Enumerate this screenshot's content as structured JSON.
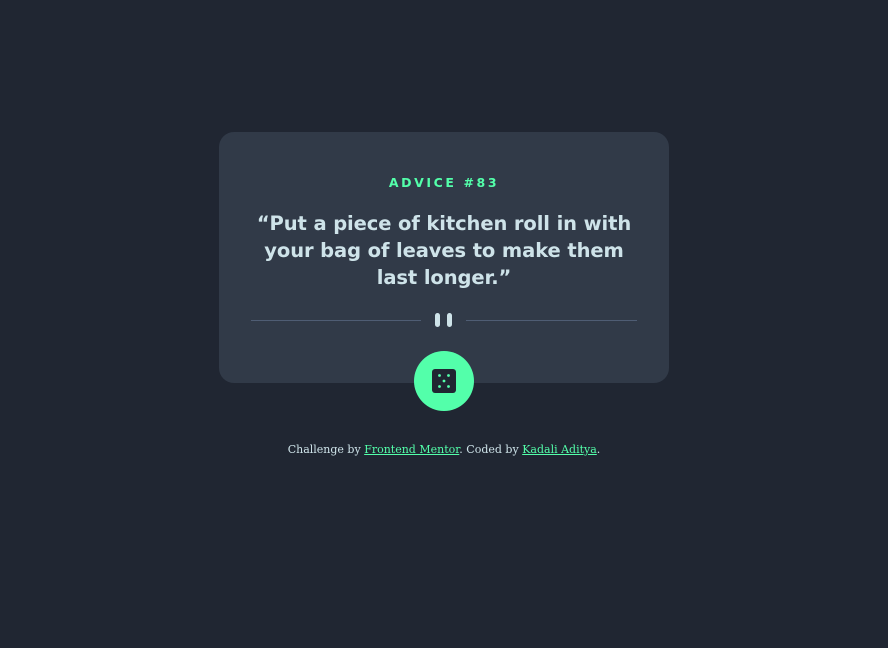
{
  "card": {
    "advice_label": "ADVICE #83",
    "quote": "“Put a piece of kitchen roll in with your bag of leaves to make them last longer.”"
  },
  "icons": {
    "divider": "pause-icon",
    "button": "dice-icon"
  },
  "footer": {
    "prefix": "Challenge by",
    "link1_text": "Frontend Mentor",
    "middle": ". Coded by",
    "link2_text": "Kadali Aditya",
    "suffix": "."
  },
  "colors": {
    "background": "#202632",
    "card": "#313a48",
    "accent": "#53ffaa",
    "text": "#cee3e9",
    "divider": "#4f5d74"
  }
}
